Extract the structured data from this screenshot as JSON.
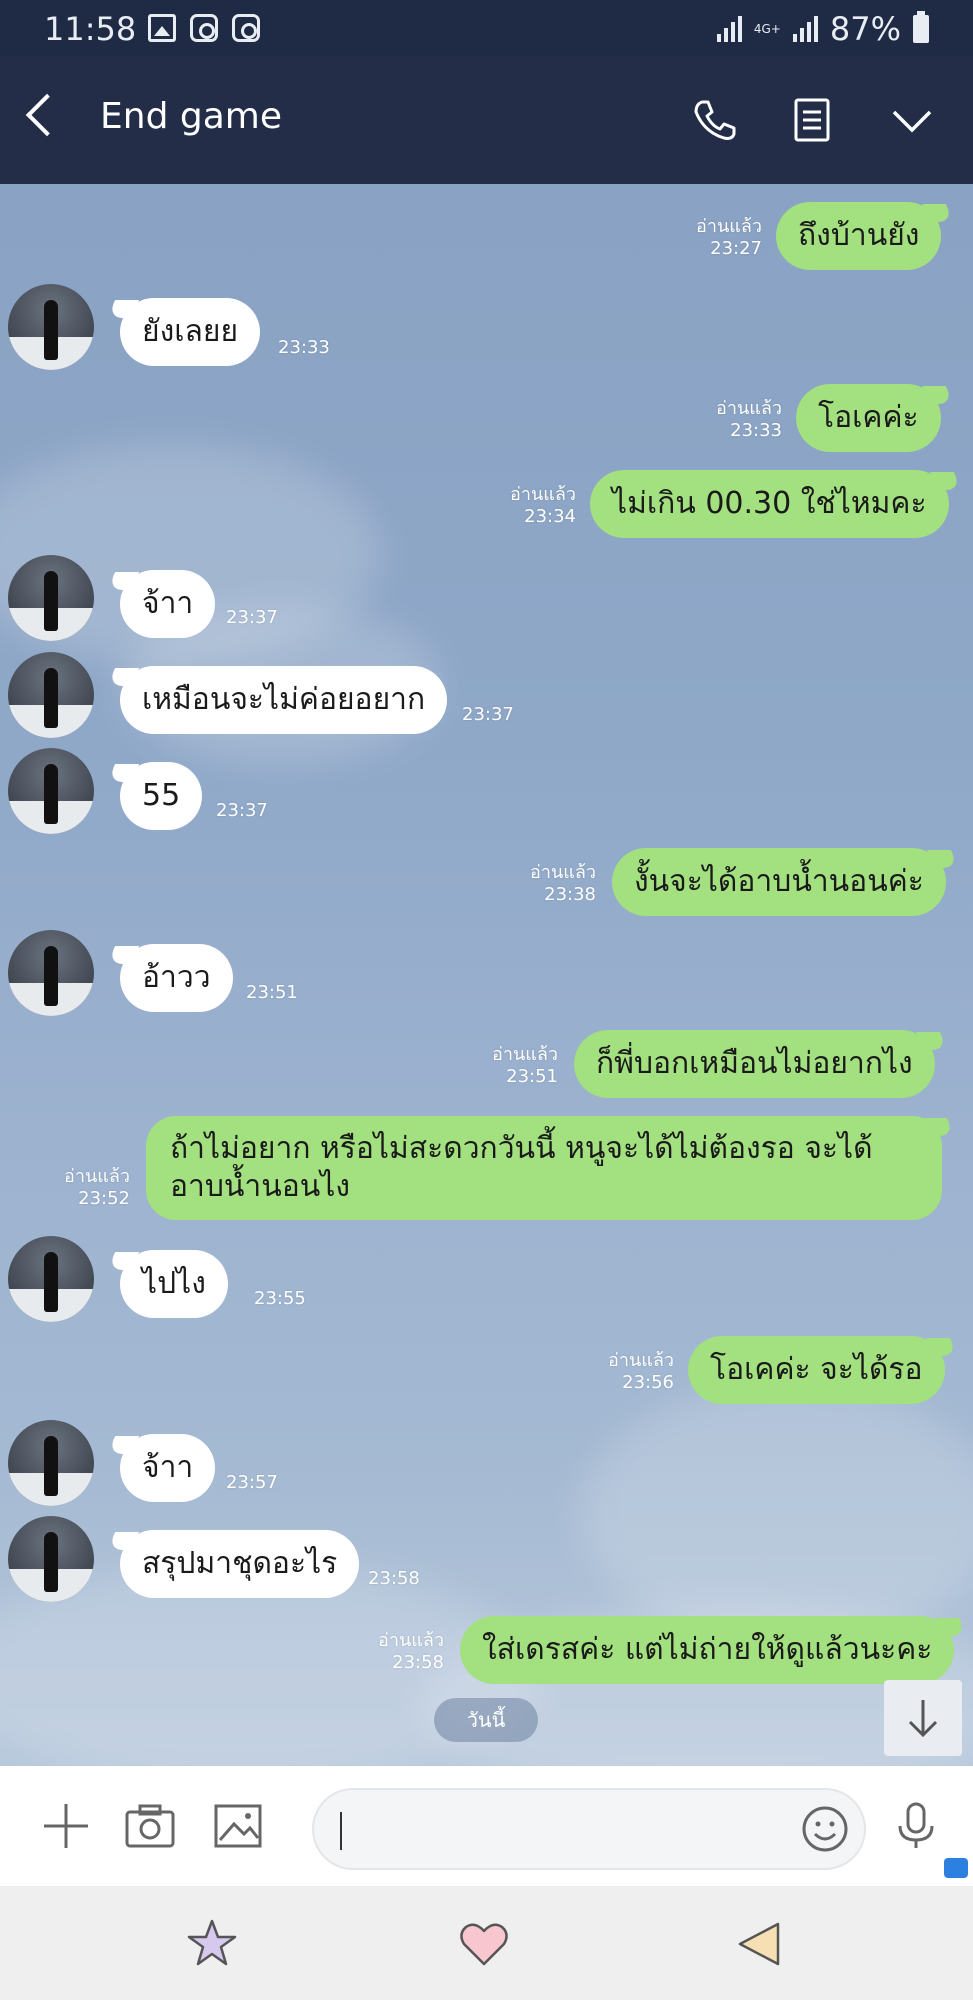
{
  "status_bar": {
    "time": "11:58",
    "network": "4G+",
    "battery": "87%"
  },
  "header": {
    "title": "End game"
  },
  "messages": [
    {
      "side": "out",
      "text": "ถึงบ้านยัง",
      "read": "อ่านแล้ว",
      "time": "23:27"
    },
    {
      "side": "in",
      "text": "ยังเลยย",
      "time": "23:33"
    },
    {
      "side": "out",
      "text": "โอเคค่ะ",
      "read": "อ่านแล้ว",
      "time": "23:33"
    },
    {
      "side": "out",
      "text": "ไม่เกิน 00.30 ใช่ไหมคะ",
      "read": "อ่านแล้ว",
      "time": "23:34"
    },
    {
      "side": "in",
      "text": "จ้าา",
      "time": "23:37"
    },
    {
      "side": "in",
      "text": "เหมือนจะไม่ค่อยอยาก",
      "time": "23:37"
    },
    {
      "side": "in",
      "text": "55",
      "time": "23:37"
    },
    {
      "side": "out",
      "text": "งั้นจะได้อาบน้ำนอนค่ะ",
      "read": "อ่านแล้ว",
      "time": "23:38"
    },
    {
      "side": "in",
      "text": "อ้าวว",
      "time": "23:51"
    },
    {
      "side": "out",
      "text": "ก็พี่บอกเหมือนไม่อยากไง",
      "read": "อ่านแล้ว",
      "time": "23:51"
    },
    {
      "side": "out",
      "text": "ถ้าไม่อยาก หรือไม่สะดวกวันนี้ หนูจะได้ไม่ต้องรอ จะได้อาบน้ำนอนไง",
      "read": "อ่านแล้ว",
      "time": "23:52"
    },
    {
      "side": "in",
      "text": "ไปไง",
      "time": "23:55"
    },
    {
      "side": "out",
      "text": "โอเคค่ะ จะได้รอ",
      "read": "อ่านแล้ว",
      "time": "23:56"
    },
    {
      "side": "in",
      "text": "จ้าา",
      "time": "23:57"
    },
    {
      "side": "in",
      "text": "สรุปมาชุดอะไร",
      "time": "23:58"
    },
    {
      "side": "out",
      "text": "ใส่เดรสค่ะ แต่ไม่ถ่ายให้ดูแล้วนะคะ",
      "read": "อ่านแล้ว",
      "time": "23:58"
    }
  ],
  "date_chip": "วันนี้",
  "input": {
    "placeholder": ""
  },
  "icons": {
    "header": [
      "back-icon",
      "phone-icon",
      "notes-icon",
      "chevron-down-icon"
    ],
    "input_bar": [
      "plus-icon",
      "camera-icon",
      "image-icon",
      "emoji-icon",
      "microphone-icon"
    ],
    "nav": [
      "star-icon",
      "heart-icon",
      "back-triangle-icon"
    ]
  },
  "colors": {
    "header": "#232d48",
    "outgoing_bubble": "#a3e07f",
    "incoming_bubble": "#ffffff",
    "chat_bg": "#8aa3c4"
  }
}
